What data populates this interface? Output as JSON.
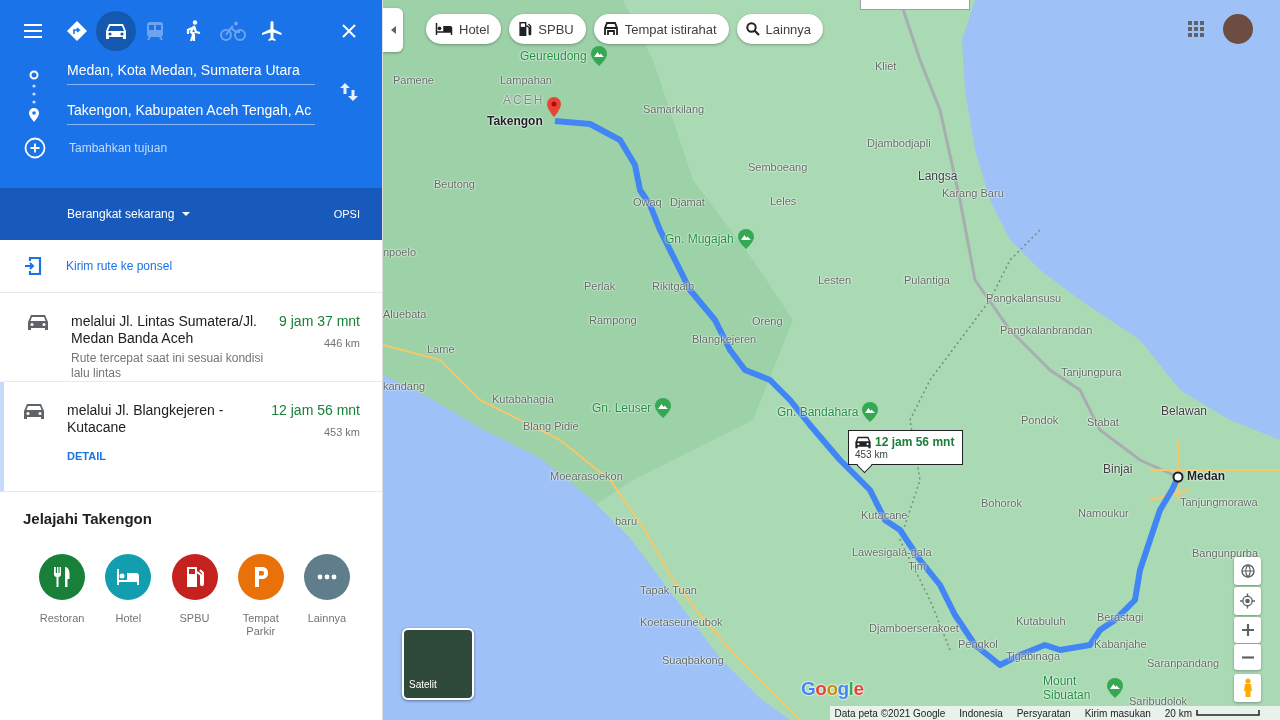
{
  "panel": {
    "modes": [
      {
        "kind": "best",
        "selected": false,
        "disabled": false
      },
      {
        "kind": "drive",
        "selected": true,
        "disabled": false
      },
      {
        "kind": "transit",
        "selected": false,
        "disabled": true
      },
      {
        "kind": "walk",
        "selected": false,
        "disabled": false
      },
      {
        "kind": "bicycle",
        "selected": false,
        "disabled": true
      },
      {
        "kind": "flight",
        "selected": false,
        "disabled": false
      }
    ],
    "origin": "Medan, Kota Medan, Sumatera Utara",
    "destination": "Takengon, Kabupaten Aceh Tengah, Ac",
    "add_stop": {
      "placeholder": "Tambahkan tujuan"
    },
    "depart": "Berangkat sekarang",
    "options": "OPSI",
    "send_to_phone": "Kirim rute ke ponsel",
    "routes": [
      {
        "via": "melalui Jl. Lintas Sumatera/Jl. Medan Banda Aceh",
        "duration": "9 jam 37 mnt",
        "distance": "446 km",
        "note": "Rute tercepat saat ini sesuai kondisi lalu lintas",
        "selected": false
      },
      {
        "via": "melalui Jl. Blangkejeren - Kutacane",
        "duration": "12 jam 56 mnt",
        "distance": "453 km",
        "link": "DETAIL",
        "selected": true
      }
    ],
    "explore": {
      "title": "Jelajahi Takengon",
      "items": [
        {
          "kind": "restaurant",
          "label": "Restoran",
          "color": "#188038"
        },
        {
          "kind": "hotel",
          "label": "Hotel",
          "color": "#129eaf"
        },
        {
          "kind": "gas",
          "label": "SPBU",
          "color": "#c5221f"
        },
        {
          "kind": "parking",
          "label": "Tempat Parkir",
          "color": "#e8710a"
        },
        {
          "kind": "more",
          "label": "Lainnya",
          "color": "#607d8b"
        }
      ]
    }
  },
  "map": {
    "chips": [
      {
        "kind": "hotel",
        "label": "Hotel"
      },
      {
        "kind": "gas",
        "label": "SPBU"
      },
      {
        "kind": "rest",
        "label": "Tempat istirahat"
      },
      {
        "kind": "search",
        "label": "Lainnya"
      }
    ],
    "places": [
      {
        "name": "Geureudong",
        "kind": "peak"
      },
      {
        "name": "Kliet",
        "kind": "town"
      },
      {
        "name": "Pamene",
        "kind": "town"
      },
      {
        "name": "Lampahan",
        "kind": "town"
      },
      {
        "name": "ACEH",
        "kind": "region"
      },
      {
        "name": "Samarkilang",
        "kind": "town"
      },
      {
        "name": "Takengon",
        "kind": "city"
      },
      {
        "name": "Djambodjapli",
        "kind": "town"
      },
      {
        "name": "Semboeang",
        "kind": "town"
      },
      {
        "name": "Beutong",
        "kind": "town"
      },
      {
        "name": "Langsa",
        "kind": "major"
      },
      {
        "name": "Owaq",
        "kind": "town"
      },
      {
        "name": "Djamat",
        "kind": "town"
      },
      {
        "name": "Leles",
        "kind": "town"
      },
      {
        "name": "Karang Baru",
        "kind": "town"
      },
      {
        "name": "Gn. Mugajah",
        "kind": "peak"
      },
      {
        "name": "npoelo",
        "kind": "town"
      },
      {
        "name": "Perlak",
        "kind": "town"
      },
      {
        "name": "Rikitgaib",
        "kind": "town"
      },
      {
        "name": "Lesten",
        "kind": "town"
      },
      {
        "name": "Pulantiga",
        "kind": "town"
      },
      {
        "name": "Pangkalansusu",
        "kind": "town"
      },
      {
        "name": "Aluebata",
        "kind": "town"
      },
      {
        "name": "Rampong",
        "kind": "town"
      },
      {
        "name": "Oreng",
        "kind": "town"
      },
      {
        "name": "Pangkalanbrandan",
        "kind": "town"
      },
      {
        "name": "Lame",
        "kind": "town"
      },
      {
        "name": "Blangkejeren",
        "kind": "town"
      },
      {
        "name": "Tanjungpura",
        "kind": "town"
      },
      {
        "name": "kandang",
        "kind": "town"
      },
      {
        "name": "Kutabahagia",
        "kind": "town"
      },
      {
        "name": "Gn. Leuser",
        "kind": "peak"
      },
      {
        "name": "Blang Pidie",
        "kind": "town"
      },
      {
        "name": "Gn. Bandahara",
        "kind": "peak"
      },
      {
        "name": "Pondok",
        "kind": "town"
      },
      {
        "name": "Stabat",
        "kind": "town"
      },
      {
        "name": "Belawan",
        "kind": "major"
      },
      {
        "name": "Moearasoekon",
        "kind": "town"
      },
      {
        "name": "Binjai",
        "kind": "major"
      },
      {
        "name": "Medan",
        "kind": "city"
      },
      {
        "name": "baru",
        "kind": "town"
      },
      {
        "name": "Kutacane",
        "kind": "town"
      },
      {
        "name": "Bohorok",
        "kind": "town"
      },
      {
        "name": "Namoukur",
        "kind": "town"
      },
      {
        "name": "Tanjungmorawa",
        "kind": "town"
      },
      {
        "name": "Lawesigala-gala",
        "kind": "town"
      },
      {
        "name": "Bangunpurba",
        "kind": "town"
      },
      {
        "name": "Tim",
        "kind": "town"
      },
      {
        "name": "Tapak Tuan",
        "kind": "town"
      },
      {
        "name": "Koetaseuneubok",
        "kind": "town"
      },
      {
        "name": "Djamboerserakoet",
        "kind": "town"
      },
      {
        "name": "Kutabuluh",
        "kind": "town"
      },
      {
        "name": "Berastagi",
        "kind": "town"
      },
      {
        "name": "Suaqbakong",
        "kind": "town"
      },
      {
        "name": "Pengkol",
        "kind": "town"
      },
      {
        "name": "Tigabinaga",
        "kind": "town"
      },
      {
        "name": "Kabanjahe",
        "kind": "town"
      },
      {
        "name": "Saranpandang",
        "kind": "town"
      },
      {
        "name": "Mount Sibuatan",
        "kind": "peak_stacked"
      },
      {
        "name": "Saribudolok",
        "kind": "town"
      }
    ],
    "callout": {
      "duration": "12 jam 56 mnt",
      "distance": "453 km"
    },
    "satellite": "Satelit",
    "logo": "Google",
    "footer": {
      "data": "Data peta ©2021 Google",
      "region": "Indonesia",
      "terms": "Persyaratan",
      "feedback": "Kirim masukan",
      "scale": "20 km"
    }
  }
}
